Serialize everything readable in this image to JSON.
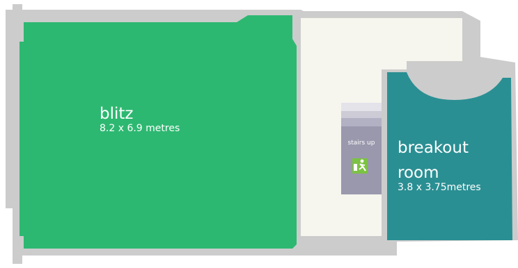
{
  "floorplan": {
    "rooms": [
      {
        "id": "blitz",
        "name": "blitz",
        "dimensions": "8.2 x 6.9 metres",
        "color": "#2db871"
      },
      {
        "id": "breakout",
        "name_line1": "breakout",
        "name_line2": "room",
        "dimensions": "3.8 x 3.75metres",
        "color": "#2a8f93"
      }
    ],
    "stairs": {
      "label": "stairs up",
      "icon": "emergency-exit-running-man-icon"
    },
    "colors": {
      "wall": "#cccccc",
      "corridor": "#f6f5ee",
      "stairs": "#9a98ad",
      "exit_sign": "#7cc243"
    }
  }
}
